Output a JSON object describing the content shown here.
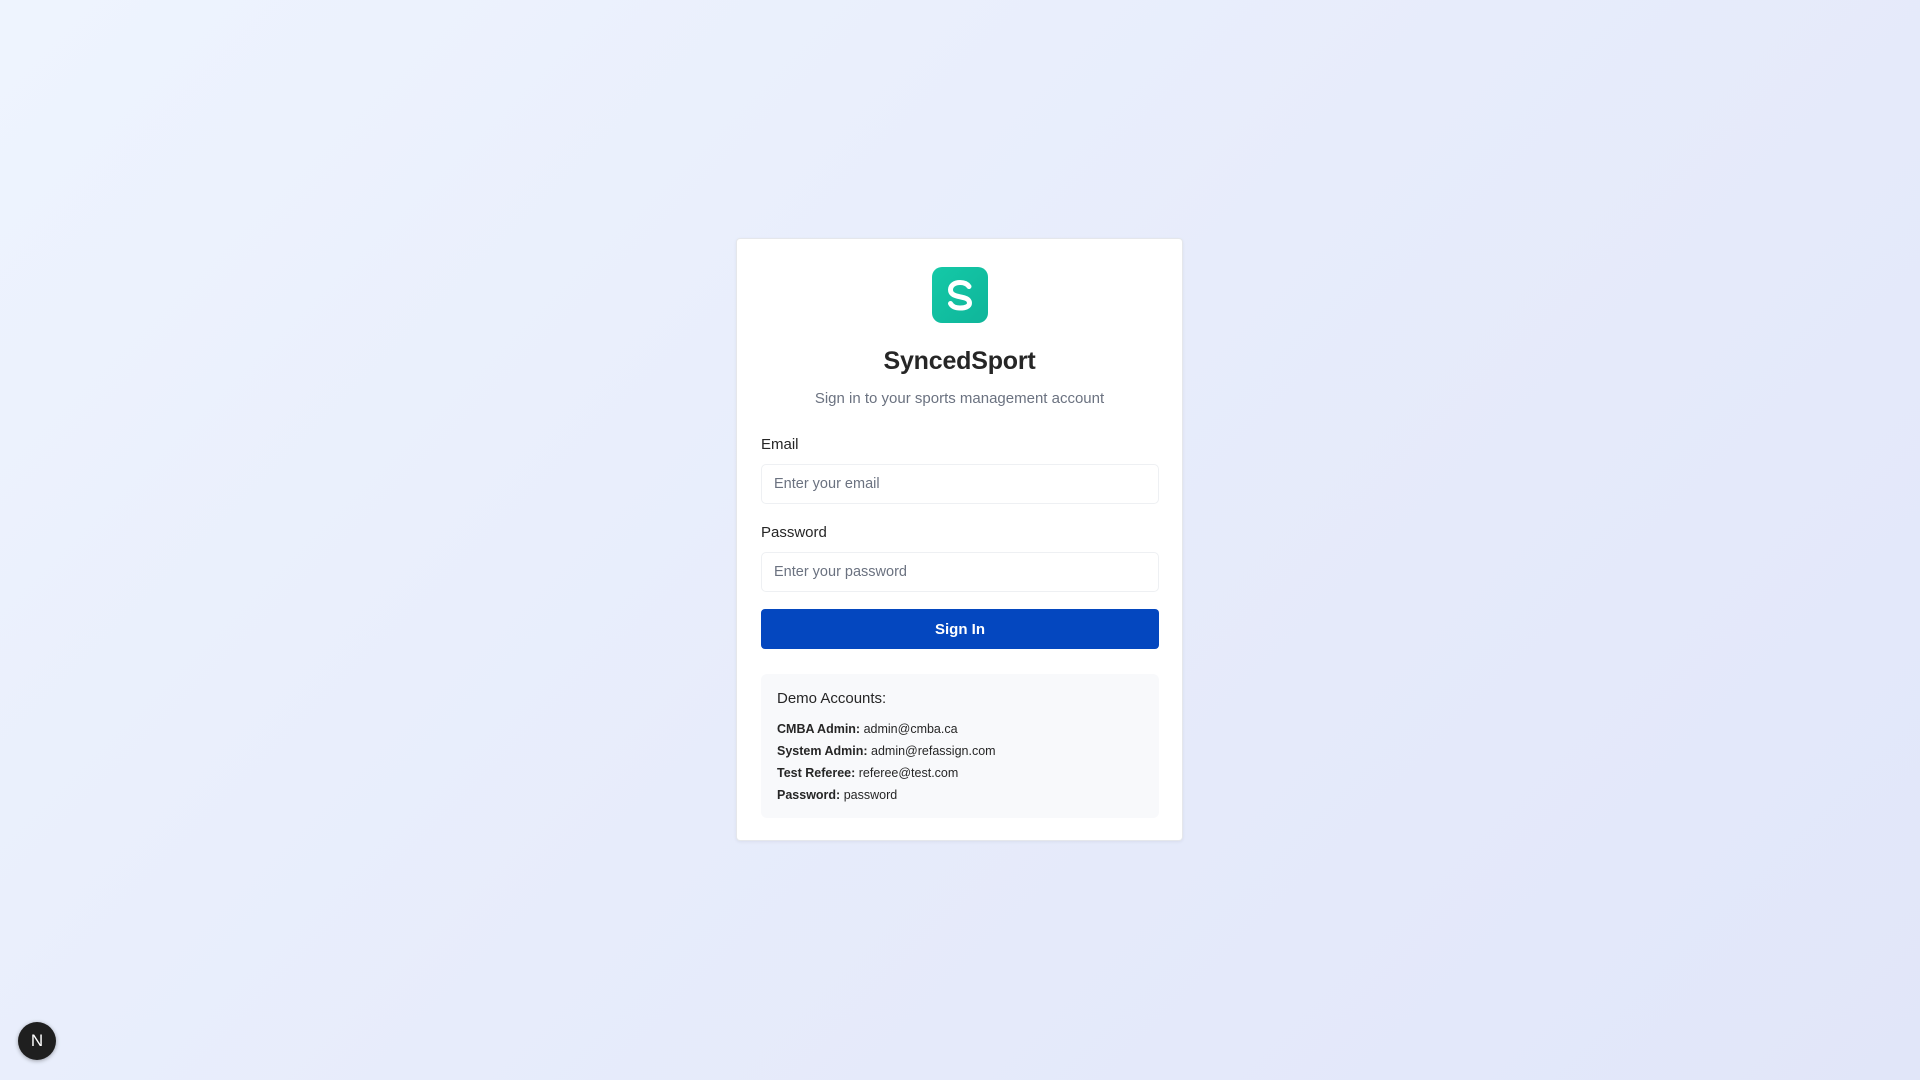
{
  "app": {
    "name": "SyncedSport",
    "subtitle": "Sign in to your sports management account",
    "logo_letter": "S",
    "logo_color": "#14c9a7"
  },
  "form": {
    "email_label": "Email",
    "email_value": "",
    "email_placeholder": "Enter your email",
    "password_label": "Password",
    "password_value": "",
    "password_placeholder": "Enter your password",
    "submit_label": "Sign In",
    "submit_color": "#0447bf"
  },
  "demo": {
    "title": "Demo Accounts:",
    "accounts": [
      {
        "label": "CMBA Admin:",
        "value": "admin@cmba.ca"
      },
      {
        "label": "System Admin:",
        "value": "admin@refassign.com"
      },
      {
        "label": "Test Referee:",
        "value": "referee@test.com"
      },
      {
        "label": "Password:",
        "value": "password"
      }
    ]
  },
  "dev_badge": {
    "icon": "nextjs-icon",
    "letter": "N"
  }
}
